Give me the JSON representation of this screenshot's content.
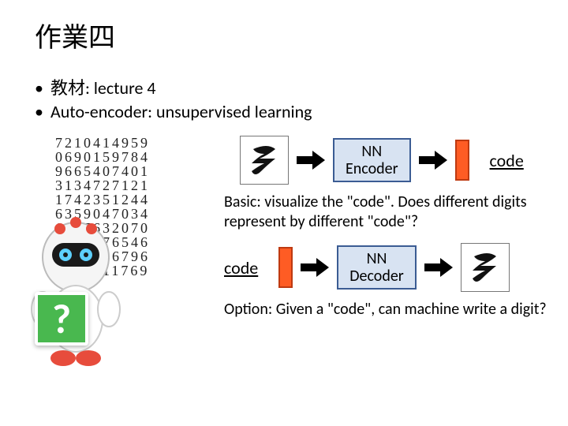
{
  "title": "作業四",
  "bullets": {
    "b1": "教材: lecture 4",
    "b2": "Auto-encoder: unsupervised learning"
  },
  "digits": {
    "r0": "7210414959",
    "r1": "0690159784",
    "r2": "9665407401",
    "r3": "3134727121",
    "r4": "1742351244",
    "r5": "6359047034",
    "r6": "6887632070",
    "r7": "7163876546",
    "r8": "2094146796",
    "r9": "6800411769"
  },
  "qmark": "?",
  "diagram": {
    "nn_encoder_l1": "NN",
    "nn_encoder_l2": "Encoder",
    "nn_decoder_l1": "NN",
    "nn_decoder_l2": "Decoder",
    "code_label": "code",
    "basic": "Basic: visualize the \"code\". Does different digits represent by different \"code\"?",
    "option": "Option: Given a \"code\", can machine write a digit?"
  }
}
